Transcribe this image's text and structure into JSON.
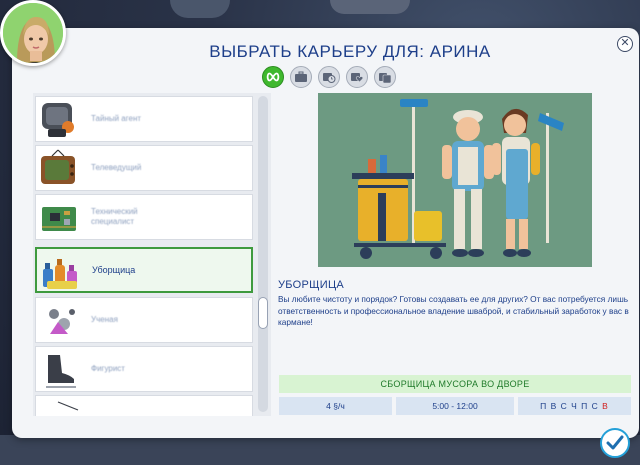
{
  "dialog": {
    "title": "ВЫБРАТЬ КАРЬЕРУ ДЛЯ: АРИНА",
    "close_icon": "close-icon",
    "confirm_icon": "checkmark-icon"
  },
  "filters": [
    {
      "name": "all-careers-filter",
      "icon": "infinity-icon",
      "active": true
    },
    {
      "name": "career-type-filter-1",
      "icon": "briefcase-icon",
      "active": false
    },
    {
      "name": "career-type-filter-2",
      "icon": "clock-icon",
      "active": false
    },
    {
      "name": "career-type-filter-3",
      "icon": "heart-icon",
      "active": false
    },
    {
      "name": "career-type-filter-4",
      "icon": "stack-icon",
      "active": false
    }
  ],
  "careers": [
    {
      "label": "Тайный агент",
      "icon": "secret-agent-icon",
      "selected": false
    },
    {
      "label": "Телеведущий",
      "icon": "television-icon",
      "selected": false
    },
    {
      "label": "Технический специалист",
      "icon": "circuit-board-icon",
      "selected": false
    },
    {
      "label": "Уборщица",
      "icon": "cleaning-supplies-icon",
      "selected": true
    },
    {
      "label": "Ученая",
      "icon": "science-icon",
      "selected": false
    },
    {
      "label": "Фигурист",
      "icon": "ice-skate-icon",
      "selected": false
    }
  ],
  "detail": {
    "title": "УБОРЩИЦА",
    "description": "Вы любите чистоту и порядок? Готовы создавать ее для других? От вас потребуется лишь ответственность и профессиональное владение шваброй, и стабильный заработок у вас в кармане!",
    "job_title": "СБОРЩИЦА МУСОРА ВО ДВОРЕ",
    "pay_amount": "4",
    "pay_unit": "§/ч",
    "hours": "5:00 - 12:00",
    "days_workdays": "П В С Ч П С",
    "days_off": "В"
  },
  "colors": {
    "accent": "#1e3f8a",
    "job_bg": "#d8f3d2",
    "job_text": "#1f7a2a",
    "active_filter": "#3fb82e",
    "day_off": "#d12020"
  }
}
